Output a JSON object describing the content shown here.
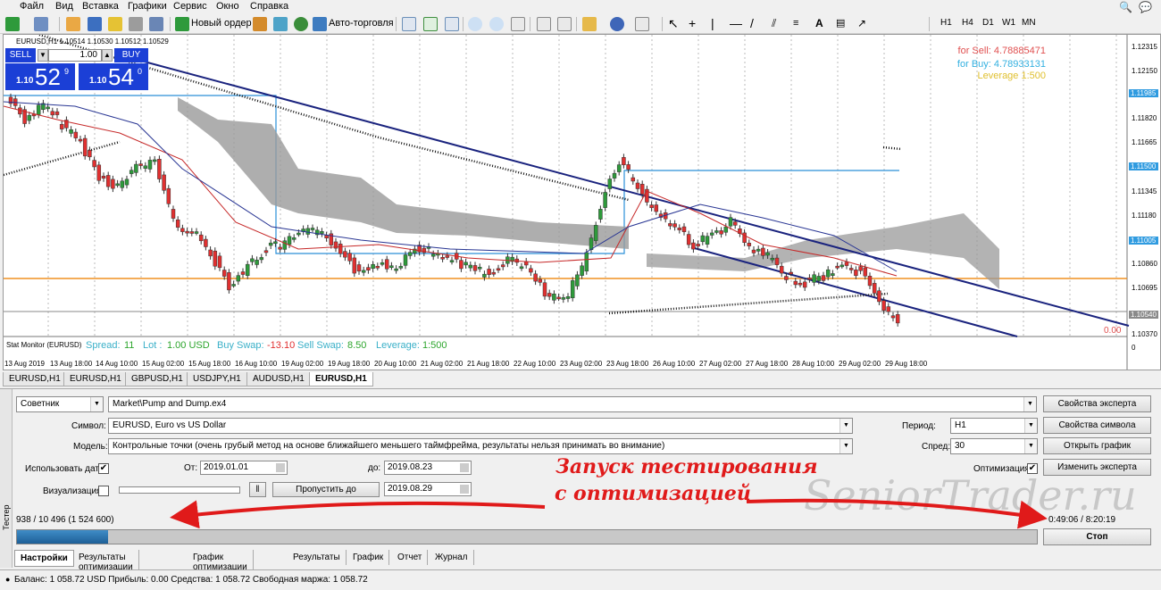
{
  "menu": [
    "Файл",
    "Вид",
    "Вставка",
    "Графики",
    "Сервис",
    "Окно",
    "Справка"
  ],
  "toolbar": {
    "new_order": "Новый ордер",
    "auto_trading": "Авто-торговля",
    "timeframes": [
      "H1",
      "H4",
      "D1",
      "W1",
      "MN"
    ]
  },
  "chart": {
    "symbol_line": "EURUSD,H1  1.10514 1.10530 1.10512 1.10529",
    "one_click": {
      "sell": "SELL",
      "buy": "BUY",
      "lot": "1.00",
      "sell_prefix": "1.10",
      "sell_big": "52",
      "sell_sup": "9",
      "buy_prefix": "1.10",
      "buy_big": "54",
      "buy_sup": "0"
    },
    "account": {
      "for_sell": "for Sell: 4.78885471",
      "for_buy": "for Buy: 4.78933131",
      "leverage": "Leverage 1:500"
    },
    "price_axis": [
      "1.12315",
      "1.12150",
      "1.11985",
      "1.11820",
      "1.11665",
      "1.11500",
      "1.11345",
      "1.11180",
      "1.11005",
      "1.10860",
      "1.10695",
      "1.10540",
      "1.10370"
    ],
    "zero_value": "0.00",
    "zero_axis": "0",
    "time_axis": [
      "13 Aug 2019",
      "13 Aug 18:00",
      "14 Aug 10:00",
      "15 Aug 02:00",
      "15 Aug 18:00",
      "16 Aug 10:00",
      "19 Aug 02:00",
      "19 Aug 18:00",
      "20 Aug 10:00",
      "21 Aug 02:00",
      "21 Aug 18:00",
      "22 Aug 10:00",
      "23 Aug 02:00",
      "23 Aug 18:00",
      "26 Aug 10:00",
      "27 Aug 02:00",
      "27 Aug 18:00",
      "28 Aug 10:00",
      "29 Aug 02:00",
      "29 Aug 18:00"
    ],
    "stat_monitor": {
      "title": "Stat Monitor (EURUSD)",
      "spread_label": "Spread:",
      "spread": "11",
      "lot_label": "Lot :",
      "lot": "1.00 USD",
      "buy_swap_label": "Buy Swap:",
      "buy_swap": "-13.10",
      "sell_swap_label": "Sell Swap:",
      "sell_swap": "8.50",
      "leverage_label": "Leverage:",
      "leverage": "1:500"
    }
  },
  "chart_tabs": [
    "EURUSD,H1",
    "EURUSD,H1",
    "GBPUSD,H1",
    "USDJPY,H1",
    "AUDUSD,H1",
    "EURUSD,H1"
  ],
  "tester": {
    "side_label": "Тестер",
    "type": "Советник",
    "expert": "Market\\Pump and Dump.ex4",
    "symbol_label": "Символ:",
    "symbol": "EURUSD, Euro vs US Dollar",
    "model_label": "Модель:",
    "model": "Контрольные точки (очень грубый метод на основе ближайшего меньшего таймфрейма, результаты нельзя принимать во внимание)",
    "use_date_label": "Использовать дату",
    "from_label": "От:",
    "from_date": "2019.01.01",
    "to_label": "до:",
    "to_date": "2019.08.23",
    "visual_label": "Визуализация",
    "skip_to": "Пропустить до",
    "skip_date": "2019.08.29",
    "period_label": "Период:",
    "period": "H1",
    "spread_label": "Спред:",
    "spread": "30",
    "optimization_label": "Оптимизация",
    "buttons": {
      "expert_props": "Свойства эксперта",
      "symbol_props": "Свойства символа",
      "open_chart": "Открыть график",
      "modify_expert": "Изменить эксперта",
      "stop": "Стоп"
    },
    "progress_count": "938 / 10 496 (1 524 600)",
    "progress_time": "0:49:06 / 8:20:19",
    "progress_fraction": 0.0894,
    "annotation_line1": "Запуск тестирования",
    "annotation_line2": "с оптимизацией",
    "watermark": "SeniorTrader.ru",
    "tabs": [
      "Настройки",
      "Результаты оптимизации",
      "График оптимизации",
      "Результаты",
      "График",
      "Отчет",
      "Журнал"
    ]
  },
  "status": {
    "text": "Баланс: 1 058.72 USD  Прибыль: 0.00  Средства: 1 058.72  Свободная маржа: 1 058.72"
  }
}
